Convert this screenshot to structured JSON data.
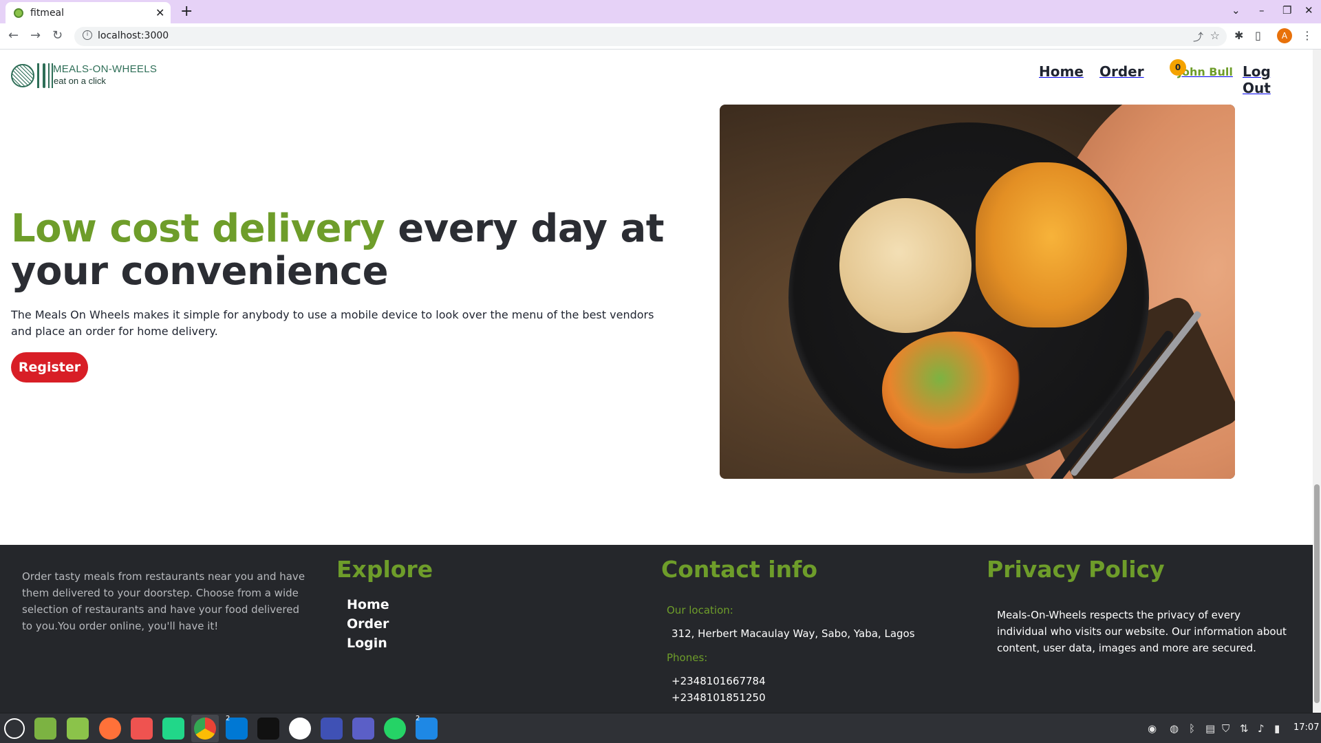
{
  "browser": {
    "tab_title": "fitmeal",
    "tab_close": "✕",
    "new_tab": "+",
    "url": "localhost:3000",
    "profile_initial": "A"
  },
  "header": {
    "logo_name": "MEALS-ON-WHEELS",
    "logo_tagline": "eat on a click",
    "nav": {
      "home": "Home",
      "order": "Order",
      "cart_count": "0",
      "user": "John Bull",
      "logout": "Log Out"
    }
  },
  "hero": {
    "title_accent": "Low cost delivery",
    "title_rest": " every day at your convenience",
    "description": "The Meals On Wheels makes it simple for anybody to use a mobile device to look over the menu of the best vendors and place an order for home delivery.",
    "register_label": "Register"
  },
  "footer": {
    "about": "Order tasty meals from restaurants near you and have them delivered to your doorstep. Choose from a wide selection of restaurants and have your food delivered to you.You order online, you'll have it!",
    "explore_heading": "Explore",
    "explore_links": [
      "Home",
      "Order",
      "Login"
    ],
    "contact_heading": "Contact info",
    "location_label": "Our location:",
    "location_value": "312, Herbert Macaulay Way, Sabo, Yaba, Lagos",
    "phones_label": "Phones:",
    "phones": [
      "+2348101667784",
      "+2348101851250"
    ],
    "privacy_heading": "Privacy Policy",
    "privacy_text": "Meals-On-Wheels respects the privacy of every individual who visits our website. Our information about content, user data, images and more are secured."
  },
  "taskbar": {
    "clock": "17:07",
    "badges": [
      "2",
      "2"
    ],
    "apps": [
      "menu-icon",
      "desktop-icon",
      "files-icon",
      "firefox-icon",
      "reader-icon",
      "pycharm-icon",
      "chrome-icon",
      "vscode-icon",
      "terminal-icon",
      "app-icon",
      "intellij-icon",
      "teams-icon",
      "whatsapp-icon",
      "editor-icon"
    ]
  },
  "colors": {
    "accent_green": "#6e9d2a",
    "register_red": "#d81e26",
    "footer_bg": "#25272b",
    "badge_orange": "#f5a300"
  }
}
